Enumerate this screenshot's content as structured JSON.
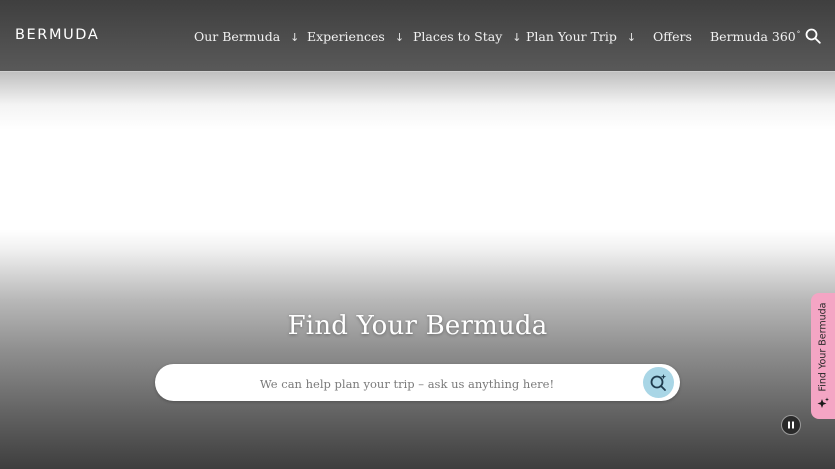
{
  "header": {
    "logo_text": "BERMUDA",
    "nav": [
      {
        "label": "Our Bermuda",
        "arrow": "↓"
      },
      {
        "label": "Experiences",
        "arrow": "↓"
      },
      {
        "label": "Places to Stay",
        "arrow": "↓"
      },
      {
        "label": "Plan Your Trip",
        "arrow": "↓"
      },
      {
        "label": "Offers"
      },
      {
        "label": "Bermuda 360",
        "suffix": "°"
      }
    ],
    "search_icon": "search-icon"
  },
  "hero": {
    "title": "Find Your Bermuda",
    "search_placeholder": "We can help plan your trip – ask us anything here!",
    "ai_search_icon": "ai-search-icon"
  },
  "side_tab": {
    "label": "Find Your Bermuda",
    "icon": "sparkle-icon",
    "color": "#f4a5c4"
  },
  "media_controls": {
    "pause_icon": "pause-icon"
  },
  "colors": {
    "header_bg": "#4a4a4a",
    "ai_button": "#a9d6e6",
    "side_tab": "#f4a5c4"
  }
}
